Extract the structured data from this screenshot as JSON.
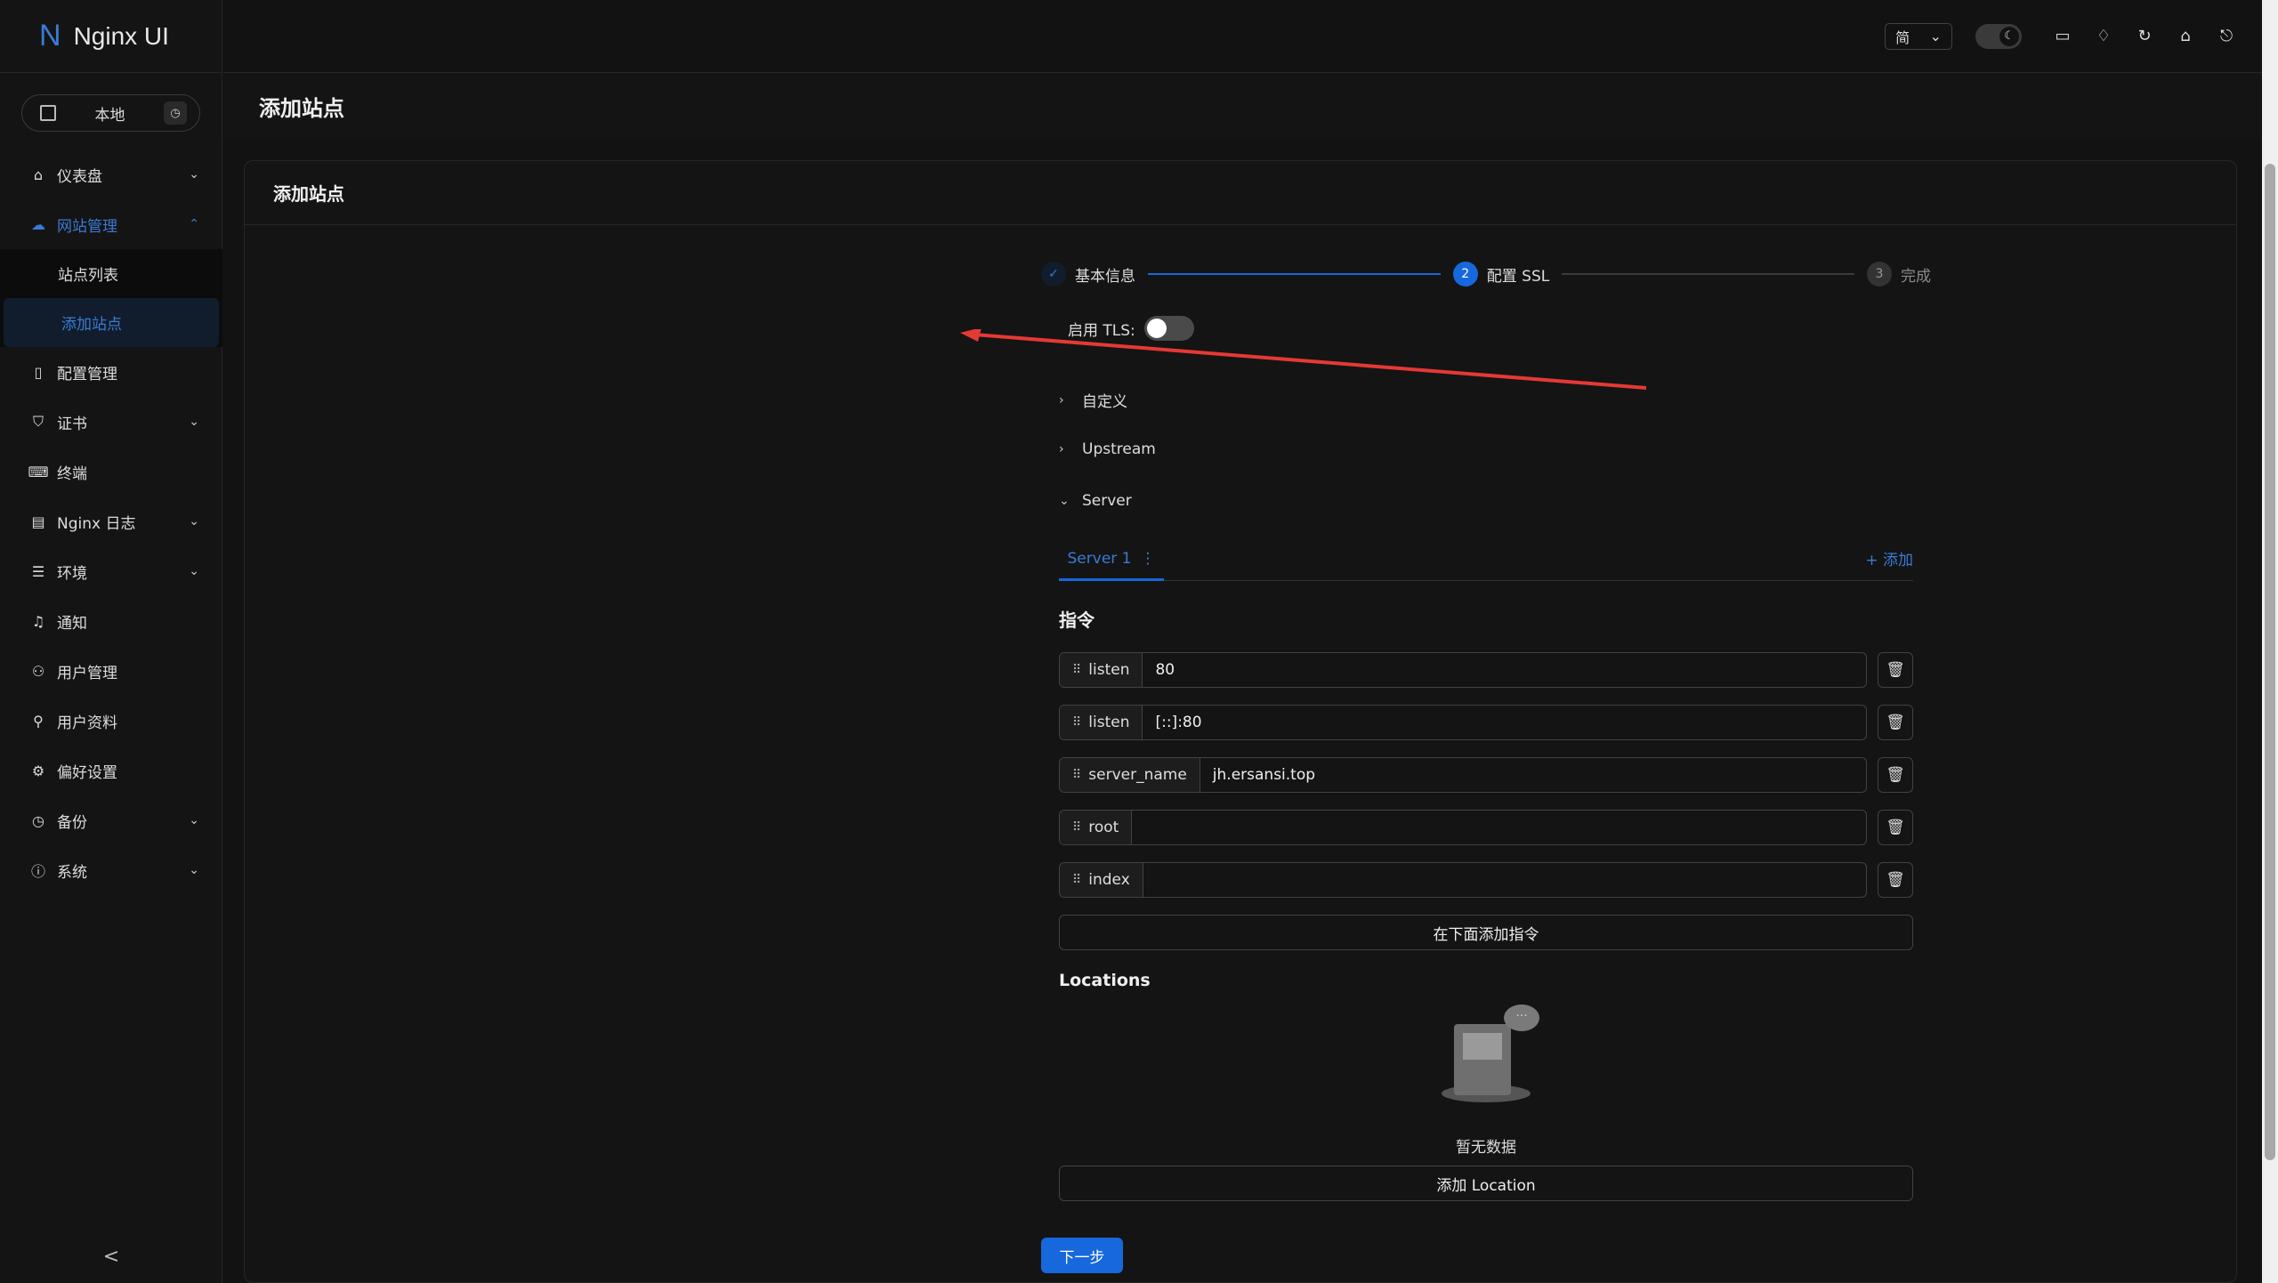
{
  "app": {
    "logo_letter": "N",
    "title": "Nginx UI"
  },
  "env_selector": {
    "label": "本地"
  },
  "sidebar": {
    "items": [
      {
        "label": "仪表盘",
        "icon": "home-icon",
        "expandable": true
      },
      {
        "label": "网站管理",
        "icon": "cloud-icon",
        "expandable": true,
        "open": true,
        "children": [
          {
            "label": "站点列表"
          },
          {
            "label": "添加站点",
            "active": true
          }
        ]
      },
      {
        "label": "配置管理",
        "icon": "file-icon"
      },
      {
        "label": "证书",
        "icon": "shield-icon",
        "expandable": true
      },
      {
        "label": "终端",
        "icon": "terminal-icon"
      },
      {
        "label": "Nginx 日志",
        "icon": "file-text-icon",
        "expandable": true
      },
      {
        "label": "环境",
        "icon": "database-icon",
        "expandable": true
      },
      {
        "label": "通知",
        "icon": "bell-icon"
      },
      {
        "label": "用户管理",
        "icon": "users-icon"
      },
      {
        "label": "用户资料",
        "icon": "user-icon"
      },
      {
        "label": "偏好设置",
        "icon": "gear-icon"
      },
      {
        "label": "备份",
        "icon": "clock-icon",
        "expandable": true
      },
      {
        "label": "系统",
        "icon": "info-icon",
        "expandable": true
      }
    ],
    "collapse_glyph": "<"
  },
  "topbar": {
    "language": "简"
  },
  "page": {
    "title": "添加站点",
    "card_title": "添加站点"
  },
  "steps": [
    {
      "label": "基本信息",
      "state": "done"
    },
    {
      "number": "2",
      "label": "配置 SSL",
      "state": "current"
    },
    {
      "number": "3",
      "label": "完成",
      "state": "waiting"
    }
  ],
  "tls": {
    "label": "启用 TLS:",
    "enabled": false
  },
  "collapses": [
    {
      "label": "自定义",
      "open": false
    },
    {
      "label": "Upstream",
      "open": false
    },
    {
      "label": "Server",
      "open": true
    }
  ],
  "server_tabs": {
    "active": "Server 1",
    "add_label": "添加"
  },
  "directives_title": "指令",
  "directives": [
    {
      "name": "listen",
      "value": "80"
    },
    {
      "name": "listen",
      "value": "[::]:80"
    },
    {
      "name": "server_name",
      "value": "jh.ersansi.top"
    },
    {
      "name": "root",
      "value": ""
    },
    {
      "name": "index",
      "value": ""
    }
  ],
  "add_directive_label": "在下面添加指令",
  "locations_title": "Locations",
  "empty_text": "暂无数据",
  "add_location_label": "添加 Location",
  "next_label": "下一步",
  "colors": {
    "primary": "#1668dc",
    "annotation_arrow": "#e53935",
    "background": "#121212"
  }
}
